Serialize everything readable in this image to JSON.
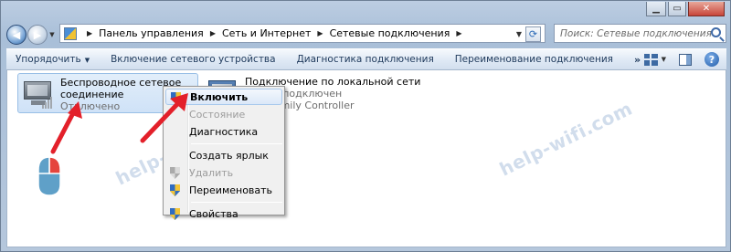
{
  "window": {
    "caption_buttons": [
      "minimize",
      "maximize",
      "close"
    ]
  },
  "address_bar": {
    "breadcrumbs": [
      "Панель управления",
      "Сеть и Интернет",
      "Сетевые подключения"
    ],
    "search_placeholder": "Поиск: Сетевые подключения"
  },
  "toolbar": {
    "items": [
      "Упорядочить",
      "Включение сетевого устройства",
      "Диагностика подключения",
      "Переименование подключения"
    ],
    "more": "»"
  },
  "connections": [
    {
      "title_line1": "Беспроводное сетевое",
      "title_line2": "соединение",
      "status": "Отключено",
      "selected": true
    },
    {
      "title_line1": "Подключение по локальной сети",
      "line2": "ель не подключен",
      "line3": "GBE Family Controller",
      "selected": false
    }
  ],
  "context_menu": {
    "items": [
      {
        "label": "Включить",
        "bold": true,
        "disabled": false,
        "icon": "shield-icon"
      },
      {
        "label": "Состояние",
        "bold": false,
        "disabled": true,
        "icon": ""
      },
      {
        "label": "Диагностика",
        "bold": false,
        "disabled": false,
        "icon": ""
      },
      {
        "label": "Создать ярлык",
        "bold": false,
        "disabled": false,
        "icon": ""
      },
      {
        "label": "Удалить",
        "bold": false,
        "disabled": true,
        "icon": "shield-icon"
      },
      {
        "label": "Переименовать",
        "bold": false,
        "disabled": false,
        "icon": "shield-icon"
      },
      {
        "label": "Свойства",
        "bold": false,
        "disabled": false,
        "icon": "shield-icon"
      }
    ]
  },
  "watermark": "help-wifi.com",
  "colors": {
    "arrow": "#e3202a",
    "mouse_body": "#5fa0c8",
    "mouse_button": "#e5443d"
  }
}
